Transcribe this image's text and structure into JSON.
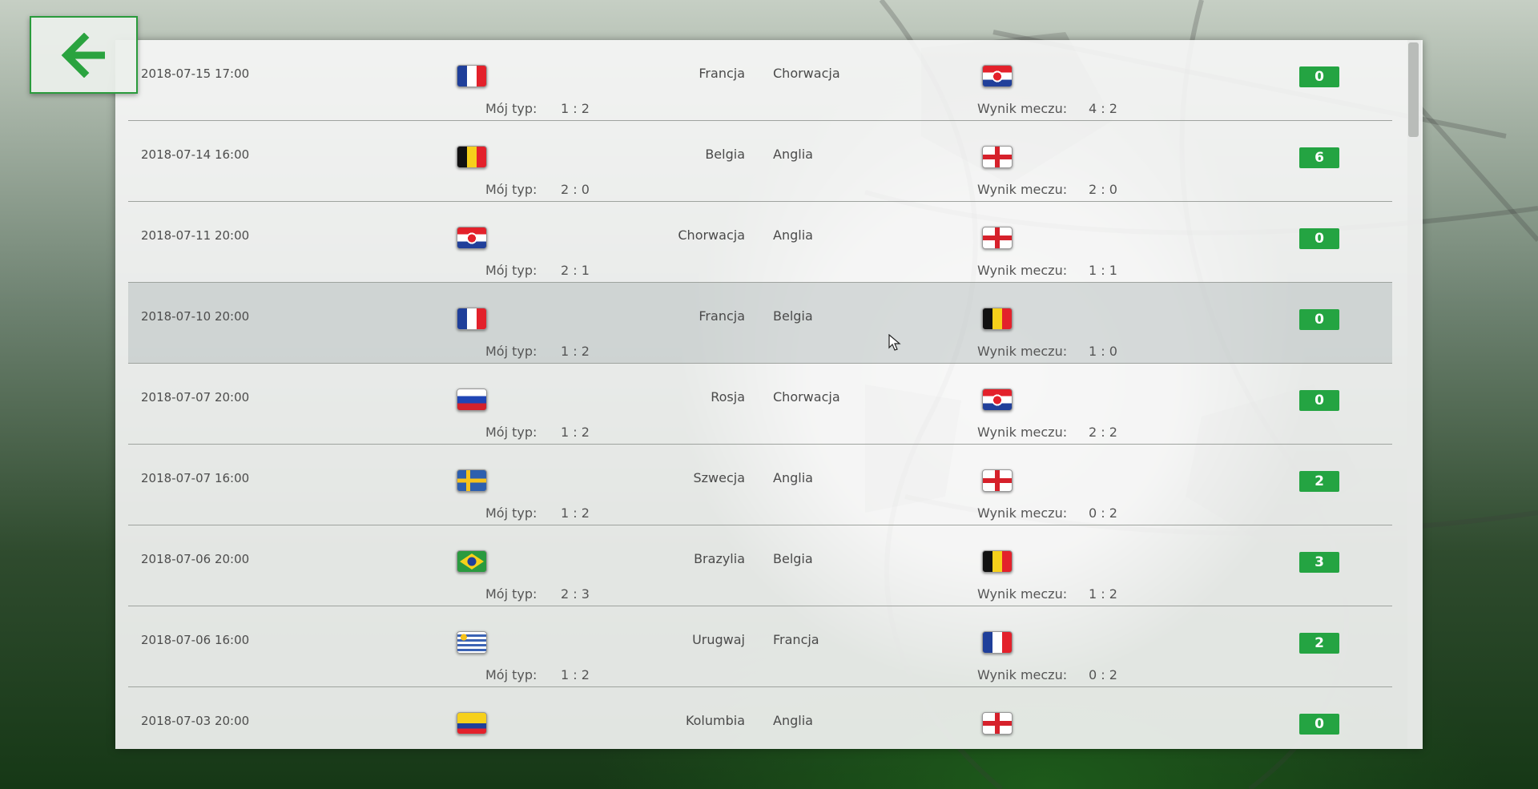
{
  "back_button": {
    "icon": "arrow-left-icon",
    "color": "#2aa33f"
  },
  "labels": {
    "my_tip": "Mój typ:",
    "result": "Wynik meczu:"
  },
  "matches": [
    {
      "date": "2018-07-15 17:00",
      "home": "Francja",
      "away": "Chorwacja",
      "home_flag": "france-flag-icon",
      "away_flag": "croatia-flag-icon",
      "tip": "1 : 2",
      "result": "4 : 2",
      "points": "0"
    },
    {
      "date": "2018-07-14 16:00",
      "home": "Belgia",
      "away": "Anglia",
      "home_flag": "belgium-flag-icon",
      "away_flag": "england-flag-icon",
      "tip": "2 : 0",
      "result": "2 : 0",
      "points": "6"
    },
    {
      "date": "2018-07-11 20:00",
      "home": "Chorwacja",
      "away": "Anglia",
      "home_flag": "croatia-flag-icon",
      "away_flag": "england-flag-icon",
      "tip": "2 : 1",
      "result": "1 : 1",
      "points": "0"
    },
    {
      "date": "2018-07-10 20:00",
      "home": "Francja",
      "away": "Belgia",
      "home_flag": "france-flag-icon",
      "away_flag": "belgium-flag-icon",
      "tip": "1 : 2",
      "result": "1 : 0",
      "points": "0"
    },
    {
      "date": "2018-07-07 20:00",
      "home": "Rosja",
      "away": "Chorwacja",
      "home_flag": "russia-flag-icon",
      "away_flag": "croatia-flag-icon",
      "tip": "1 : 2",
      "result": "2 : 2",
      "points": "0"
    },
    {
      "date": "2018-07-07 16:00",
      "home": "Szwecja",
      "away": "Anglia",
      "home_flag": "sweden-flag-icon",
      "away_flag": "england-flag-icon",
      "tip": "1 : 2",
      "result": "0 : 2",
      "points": "2"
    },
    {
      "date": "2018-07-06 20:00",
      "home": "Brazylia",
      "away": "Belgia",
      "home_flag": "brazil-flag-icon",
      "away_flag": "belgium-flag-icon",
      "tip": "2 : 3",
      "result": "1 : 2",
      "points": "3"
    },
    {
      "date": "2018-07-06 16:00",
      "home": "Urugwaj",
      "away": "Francja",
      "home_flag": "uruguay-flag-icon",
      "away_flag": "france-flag-icon",
      "tip": "1 : 2",
      "result": "0 : 2",
      "points": "2"
    },
    {
      "date": "2018-07-03 20:00",
      "home": "Kolumbia",
      "away": "Anglia",
      "home_flag": "colombia-flag-icon",
      "away_flag": "england-flag-icon",
      "tip": "",
      "result": "",
      "points": "0"
    }
  ],
  "colors": {
    "points_badge": "#24a442",
    "accent": "#2a9b3c"
  }
}
